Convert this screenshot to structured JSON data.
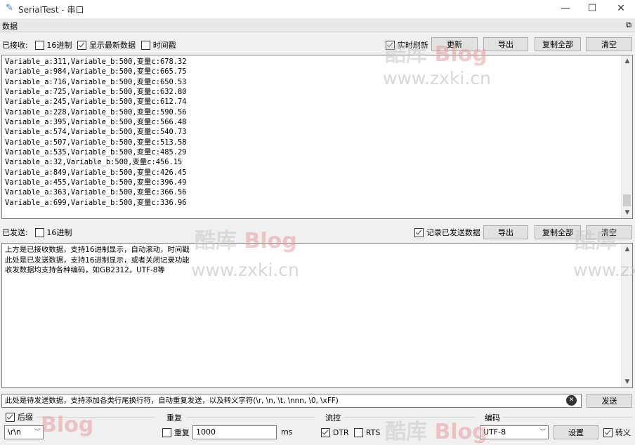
{
  "window": {
    "title": "SerialTest - 串口",
    "minimize": "—",
    "maximize": "☐",
    "close": "✕"
  },
  "section": {
    "title": "数据",
    "float_glyph": "⧉"
  },
  "received": {
    "label": "已接收:",
    "hex_label": "16进制",
    "hex_checked": false,
    "latest_label": "显示最新数据",
    "latest_checked": true,
    "timestamp_label": "时间戳",
    "timestamp_checked": false,
    "realtime_label": "实时刷新",
    "realtime_checked": true,
    "update_button": "更新",
    "export_button": "导出",
    "copy_all_button": "复制全部",
    "clear_button": "清空",
    "lines": [
      "Variable_a:311,Variable_b:500,变量c:678.32",
      "Variable_a:984,Variable_b:500,变量c:665.75",
      "Variable_a:716,Variable_b:500,变量c:650.53",
      "Variable_a:725,Variable_b:500,变量c:632.80",
      "Variable_a:245,Variable_b:500,变量c:612.74",
      "Variable_a:228,Variable_b:500,变量c:590.56",
      "Variable_a:395,Variable_b:500,变量c:566.48",
      "Variable_a:574,Variable_b:500,变量c:540.73",
      "Variable_a:507,Variable_b:500,变量c:513.58",
      "Variable_a:535,Variable_b:500,变量c:485.29",
      "Variable_a:32,Variable_b:500,变量c:456.15",
      "Variable_a:849,Variable_b:500,变量c:426.45",
      "Variable_a:455,Variable_b:500,变量c:396.49",
      "Variable_a:363,Variable_b:500,变量c:366.56",
      "Variable_a:699,Variable_b:500,变量c:336.96"
    ]
  },
  "sent": {
    "label": "已发送:",
    "hex_label": "16进制",
    "hex_checked": false,
    "record_label": "记录已发送数据",
    "record_checked": true,
    "export_button": "导出",
    "copy_all_button": "复制全部",
    "clear_button": "清空",
    "lines": [
      "上方是已接收数据，支持16进制显示，自动滚动，时间戳",
      "此处是已发送数据，支持16进制显示，或者关闭记录功能",
      "收发数据均支持各种编码，如GB2312，UTF-8等"
    ]
  },
  "send_bar": {
    "value": "此处是待发送数据，支持添加各类行尾换行符，自动重复发送，以及转义字符(\\r, \\n, \\t, \\nnn, \\0, \\xFF)",
    "clear_glyph": "✕",
    "send_button": "发送"
  },
  "options": {
    "suffix_label": "后缀",
    "suffix_checked": true,
    "suffix_value": "\\r\\n",
    "repeat_title": "重复",
    "repeat_label": "重复",
    "repeat_checked": false,
    "repeat_value": "1000",
    "repeat_unit": "ms",
    "flow_title": "流控",
    "dtr_label": "DTR",
    "dtr_checked": true,
    "rts_label": "RTS",
    "rts_checked": false,
    "encoding_title": "编码",
    "encoding_value": "UTF-8",
    "settings_button": "设置",
    "escape_label": "转义",
    "escape_checked": true
  },
  "watermark": {
    "brand_a": "酷",
    "brand_b": "库",
    "brand_c": "Blog",
    "url": "www.zxki.cn"
  }
}
